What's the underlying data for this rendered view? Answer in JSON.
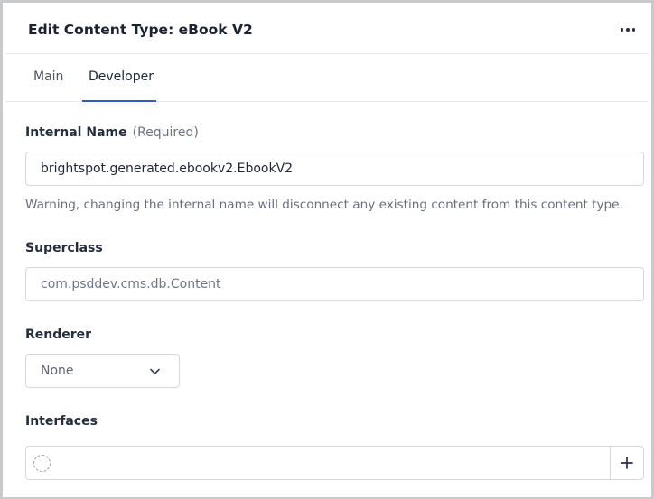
{
  "header": {
    "title": "Edit Content Type: eBook V2",
    "more_icon": "more-horizontal-icon"
  },
  "tabs": [
    {
      "label": "Main",
      "active": false
    },
    {
      "label": "Developer",
      "active": true
    }
  ],
  "accent_color": "#3358c4",
  "form": {
    "internal_name": {
      "label": "Internal Name",
      "required_text": "(Required)",
      "value": "brightspot.generated.ebookv2.EbookV2",
      "warning": "Warning, changing the internal name will disconnect any existing content from this content type."
    },
    "superclass": {
      "label": "Superclass",
      "placeholder": "com.psddev.cms.db.Content"
    },
    "renderer": {
      "label": "Renderer",
      "selected": "None",
      "icon": "chevron-down-icon"
    },
    "interfaces": {
      "label": "Interfaces",
      "loading_icon": "loading-spinner-icon",
      "add_icon": "plus-icon"
    }
  }
}
